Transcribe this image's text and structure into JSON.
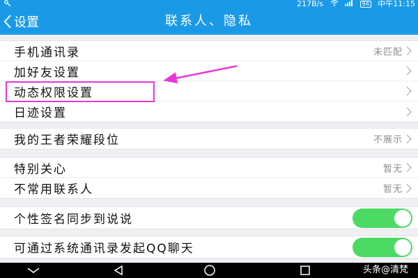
{
  "status_bar": {
    "left_icon": "key-icon",
    "network_speed": "217B/s",
    "battery": "94",
    "time": "中午11:15"
  },
  "title_bar": {
    "back_label": "设置",
    "title": "联系人、隐私"
  },
  "groups": [
    {
      "rows": [
        {
          "label": "手机通讯录",
          "value": "未匹配",
          "control": "chevron"
        },
        {
          "label": "加好友设置",
          "value": "",
          "control": "chevron"
        },
        {
          "label": "动态权限设置",
          "value": "",
          "control": "chevron",
          "highlighted": true
        },
        {
          "label": "日迹设置",
          "value": "",
          "control": "chevron"
        }
      ]
    },
    {
      "rows": [
        {
          "label": "我的王者荣耀段位",
          "value": "不展示",
          "control": "chevron"
        }
      ]
    },
    {
      "rows": [
        {
          "label": "特别关心",
          "value": "暂无",
          "control": "chevron"
        },
        {
          "label": "不常用联系人",
          "value": "暂无",
          "control": "chevron"
        }
      ]
    },
    {
      "rows": [
        {
          "label": "个性签名同步到说说",
          "control": "toggle",
          "toggle_on": true
        }
      ]
    },
    {
      "rows": [
        {
          "label": "可通过系统通讯录发起QQ聊天",
          "control": "toggle",
          "toggle_on": true
        }
      ]
    }
  ],
  "nav_bar": {
    "buttons": [
      "chevron-down-icon",
      "back-triangle-icon",
      "home-circle-icon",
      "recent-apps-icon"
    ]
  },
  "watermark": "头条@清梵",
  "colors": {
    "accent": "#1a9ae6",
    "toggle_on": "#4cd964",
    "annotation": "#e838d8",
    "background": "#eff0f4"
  }
}
